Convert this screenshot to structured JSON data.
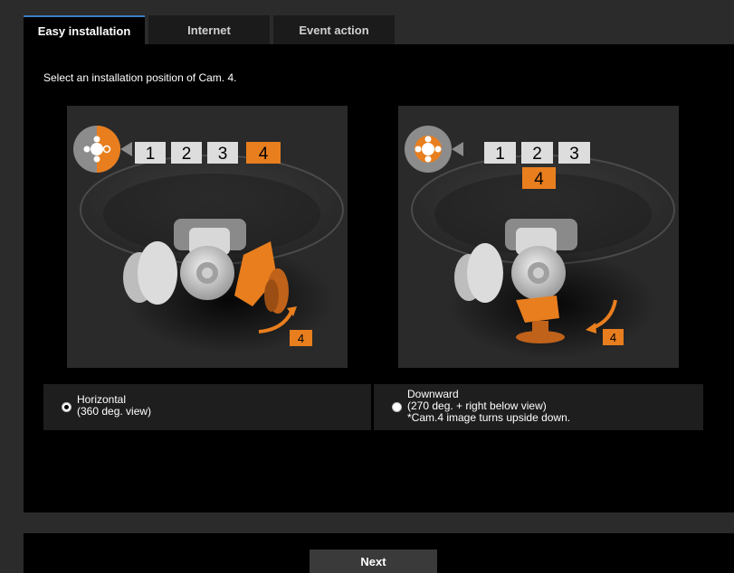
{
  "tabs": [
    {
      "label": "Easy installation",
      "active": true
    },
    {
      "label": "Internet",
      "active": false
    },
    {
      "label": "Event action",
      "active": false
    }
  ],
  "instruction": "Select an installation position of Cam. 4.",
  "illustrations": {
    "left": {
      "camera_numbers": [
        "1",
        "2",
        "3",
        "4"
      ],
      "highlighted": "4",
      "arrow_badge": "4"
    },
    "right": {
      "camera_numbers": [
        "1",
        "2",
        "3",
        "4"
      ],
      "highlighted": "4",
      "arrow_badge": "4"
    }
  },
  "options": {
    "horizontal": {
      "line1": "Horizontal",
      "line2": "(360 deg. view)",
      "selected": true
    },
    "downward": {
      "line1": "Downward",
      "line2": "(270 deg. + right below view)",
      "line3": "*Cam.4 image turns upside down.",
      "selected": false
    }
  },
  "footer": {
    "next_label": "Next"
  },
  "colors": {
    "accent": "#e87e1e",
    "tab_border": "#3a7fc1"
  }
}
